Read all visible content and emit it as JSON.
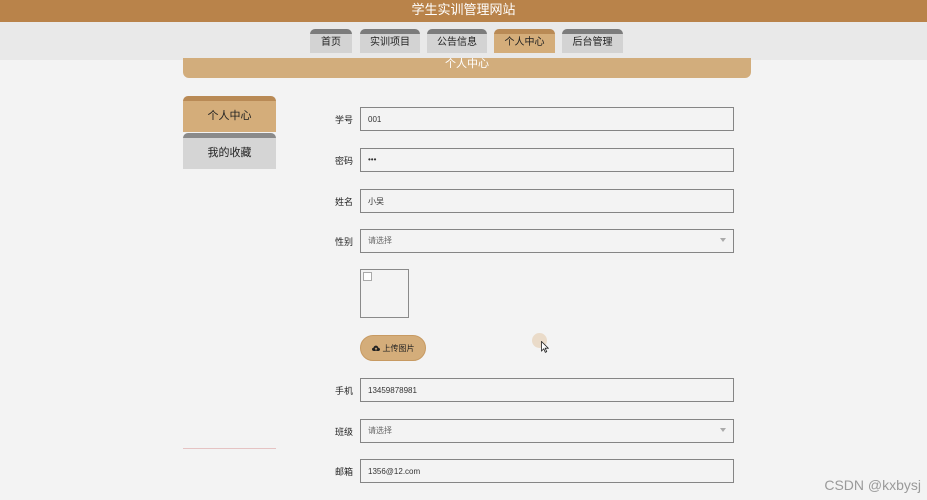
{
  "site": {
    "title": "学生实训管理网站"
  },
  "nav": {
    "items": [
      {
        "label": "首页"
      },
      {
        "label": "实训项目"
      },
      {
        "label": "公告信息"
      },
      {
        "label": "个人中心",
        "active": true
      },
      {
        "label": "后台管理"
      }
    ]
  },
  "banner": {
    "title": "个人中心"
  },
  "sidebar": {
    "items": [
      {
        "label": "个人中心",
        "active": true
      },
      {
        "label": "我的收藏"
      }
    ]
  },
  "form": {
    "student_id": {
      "label": "学号",
      "value": "001"
    },
    "password": {
      "label": "密码",
      "value": "•••"
    },
    "name": {
      "label": "姓名",
      "value": "小吴"
    },
    "gender": {
      "label": "性别",
      "placeholder": "请选择"
    },
    "upload": {
      "button_label": "上传图片",
      "icon": "cloud-upload-icon"
    },
    "phone": {
      "label": "手机",
      "value": "13459878981"
    },
    "class": {
      "label": "班级",
      "placeholder": "请选择"
    },
    "email": {
      "label": "邮箱",
      "value": "1356@12.com"
    }
  },
  "watermark": {
    "text": "CSDN @kxbysj"
  },
  "colors": {
    "header": "#b9834a",
    "accent": "#d4ad7a",
    "tab_inactive": "#d3d3d3",
    "tab_top": "#7c7c7c",
    "background": "#f3f3f3"
  }
}
